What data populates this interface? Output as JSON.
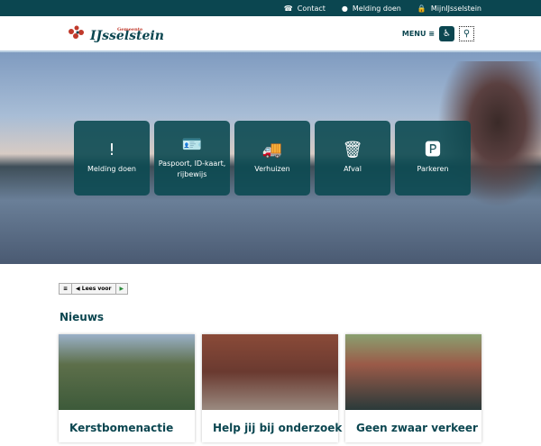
{
  "topbar": {
    "items": [
      {
        "label": "Contact",
        "icon": "phone-icon"
      },
      {
        "label": "Melding doen",
        "icon": "alert-icon"
      },
      {
        "label": "MijnIJsselstein",
        "icon": "lock-icon"
      }
    ]
  },
  "header": {
    "logo_small": "Gemeente",
    "logo_name": "IJsselstein",
    "menu_label": "MENU"
  },
  "tiles": [
    {
      "label": "Melding doen",
      "icon": "!"
    },
    {
      "label": "Paspoort, ID-kaart, rijbewijs",
      "icon": "🪪"
    },
    {
      "label": "Verhuizen",
      "icon": "🚚"
    },
    {
      "label": "Afval",
      "icon": "🗑"
    },
    {
      "label": "Parkeren",
      "icon": "🅿"
    }
  ],
  "readspeaker": {
    "label": "Lees voor"
  },
  "news": {
    "title": "Nieuws",
    "items": [
      {
        "title": "Kerstbomenactie"
      },
      {
        "title": "Help jij bij onderzoek"
      },
      {
        "title": "Geen zwaar verkeer"
      }
    ]
  },
  "colors": {
    "brand": "#0b4650"
  }
}
